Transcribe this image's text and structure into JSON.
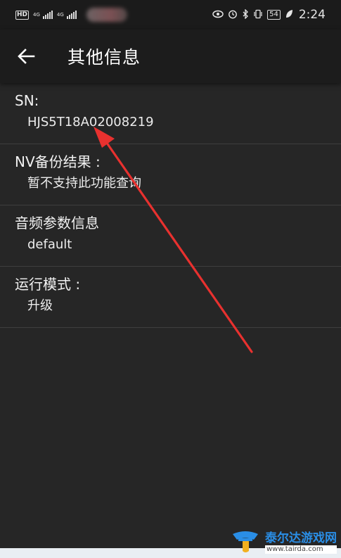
{
  "status_bar": {
    "left_badge": "HD",
    "network_1": "4G",
    "network_2": "4G",
    "right_icons": [
      "eye-icon",
      "alarm-icon",
      "bluetooth-icon",
      "vibrate-icon"
    ],
    "battery": "54",
    "time": "2:24"
  },
  "app_bar": {
    "title": "其他信息",
    "back_icon": "arrow-left-icon"
  },
  "items": [
    {
      "label": "SN:",
      "value": "HJS5T18A02008219"
    },
    {
      "label": "NV备份结果 :",
      "value": "暂不支持此功能查询"
    },
    {
      "label": "音频参数信息",
      "value": "default"
    },
    {
      "label": "运行模式 :",
      "value": "升级"
    }
  ],
  "watermark": {
    "name": "泰尔达游戏网",
    "url": "www.tairda.com",
    "logo": "tairda-logo"
  },
  "colors": {
    "background": "#262626",
    "app_bar": "#1c1c1c",
    "divider": "#3e3e3e",
    "annotation_arrow": "#e8312f",
    "watermark_blue": "#2a8ee6"
  }
}
